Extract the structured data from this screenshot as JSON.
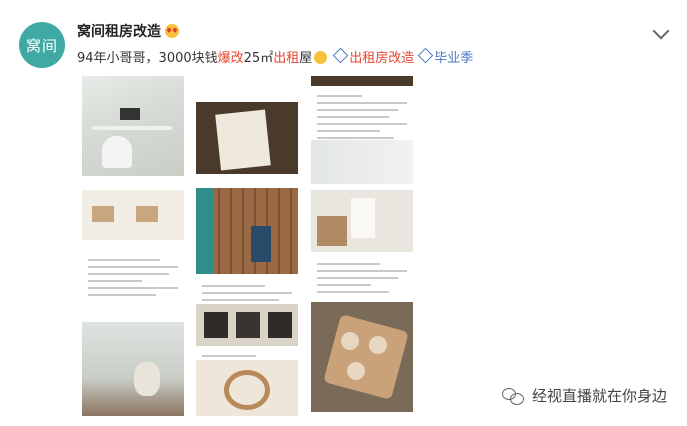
{
  "avatar_text": "窝间",
  "account_name": "窝间租房改造",
  "post": {
    "part1": "94年小哥哥，3000块钱",
    "part2": "爆改",
    "part3": "25㎡",
    "part4": "出租",
    "part5": "屋",
    "tag1": "出租房改造",
    "tag2": "毕业季"
  },
  "watermark": "经视直播就在你身边",
  "colors": {
    "accent_red": "#e8452f",
    "link_blue": "#4b79c5",
    "avatar_teal": "#3fa9a3"
  }
}
